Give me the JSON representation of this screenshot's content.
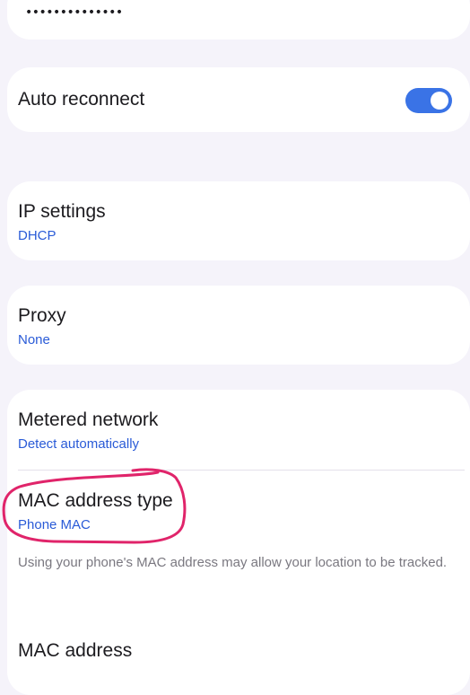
{
  "password": {
    "masked_value": "••••••••••••••"
  },
  "auto_reconnect": {
    "label": "Auto reconnect",
    "enabled": true,
    "accent_color": "#3a73e6"
  },
  "ip_settings": {
    "label": "IP settings",
    "value": "DHCP"
  },
  "proxy": {
    "label": "Proxy",
    "value": "None"
  },
  "metered_network": {
    "label": "Metered network",
    "value": "Detect automatically"
  },
  "mac_address_type": {
    "label": "MAC address type",
    "value": "Phone MAC",
    "helper": "Using your phone's MAC address may allow your location to be tracked.",
    "annotation_color": "#e0246a"
  },
  "mac_address": {
    "label": "MAC address"
  },
  "colors": {
    "value_text": "#2a5bd7",
    "background": "#f5f3fa"
  }
}
